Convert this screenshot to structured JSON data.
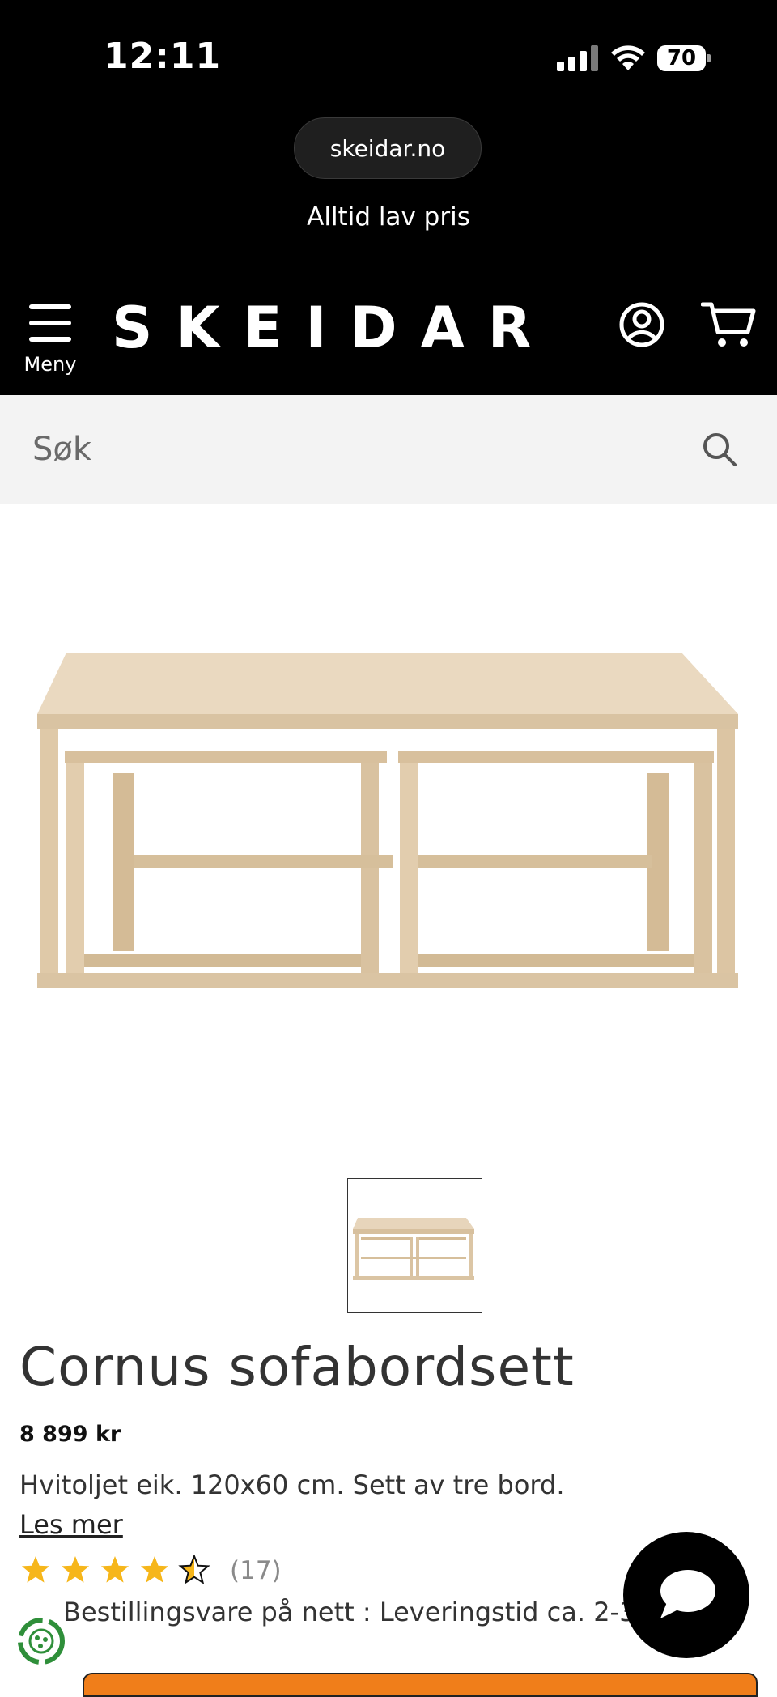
{
  "status_bar": {
    "time": "12:11",
    "battery": "70"
  },
  "browser": {
    "url": "skeidar.no"
  },
  "header": {
    "tagline": "Alltid lav pris",
    "menu_label": "Meny",
    "logo": "SKEIDAR"
  },
  "search": {
    "placeholder": "Søk"
  },
  "product": {
    "title": "Cornus sofabordsett",
    "price": "8 899 kr",
    "description": "Hvitoljet eik. 120x60 cm. Sett av tre bord.",
    "read_more": "Les mer",
    "rating": {
      "stars": 4.5,
      "max": 5,
      "count": "(17)"
    },
    "delivery": "Bestillingsvare på nett : Leveringstid ca. 2-3 uker"
  },
  "colors": {
    "accent": "#f07e1a",
    "star": "#f6b61a"
  },
  "icons": [
    "signal-icon",
    "wifi-icon",
    "battery-icon",
    "menu-icon",
    "account-icon",
    "cart-icon",
    "search-icon",
    "chat-icon",
    "eco-badge-icon"
  ]
}
